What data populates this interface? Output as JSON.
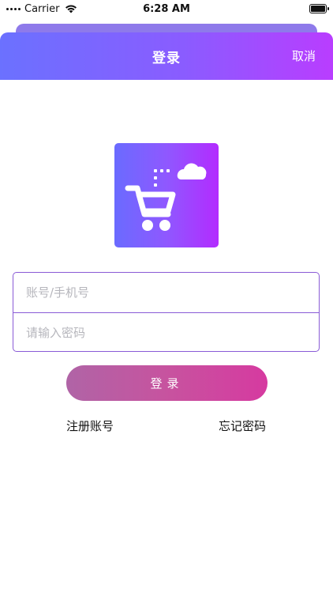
{
  "status_bar": {
    "carrier": "Carrier",
    "time": "6:28 AM"
  },
  "header": {
    "title": "登录",
    "cancel_label": "取消"
  },
  "logo": {
    "icon": "shopping-cart-cloud-icon"
  },
  "form": {
    "account_placeholder": "账号/手机号",
    "password_placeholder": "请输入密码"
  },
  "actions": {
    "login_label": "登录",
    "register_label": "注册账号",
    "forgot_label": "忘记密码"
  },
  "colors": {
    "header_gradient_start": "#6b71ff",
    "header_gradient_end": "#b93dff",
    "button_gradient_start": "#b064a6",
    "button_gradient_end": "#d63aa0",
    "input_border": "#8a5bd6"
  }
}
